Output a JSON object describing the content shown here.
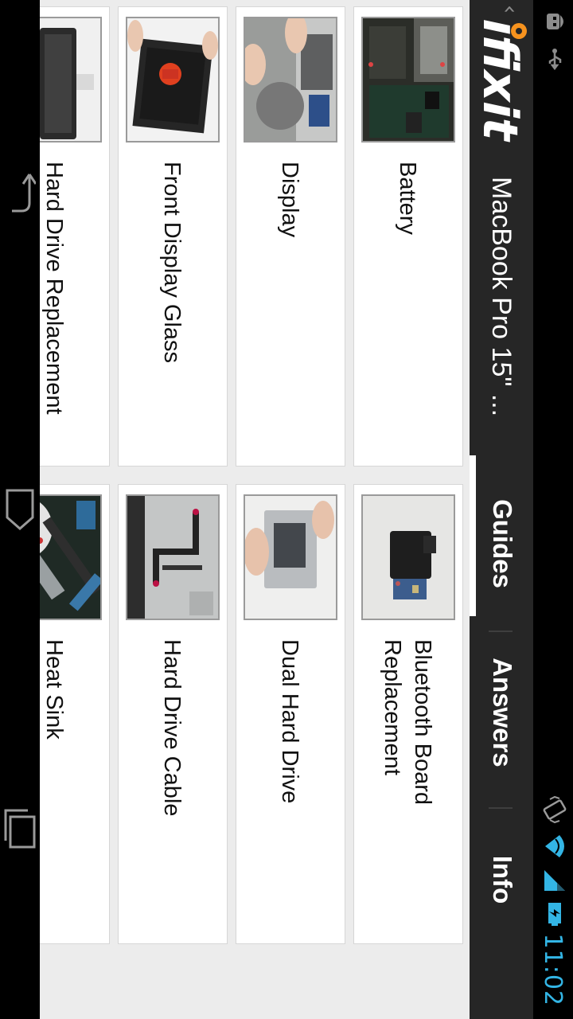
{
  "status_bar": {
    "time": "11:02"
  },
  "action_bar": {
    "logo_text": "ifixit",
    "title": "MacBook Pro 15\" ...",
    "tabs": [
      {
        "label": "Guides",
        "selected": true
      },
      {
        "label": "Answers",
        "selected": false
      },
      {
        "label": "Info",
        "selected": false
      }
    ]
  },
  "guides": [
    {
      "label": "Battery"
    },
    {
      "label": "Bluetooth Board Replacement"
    },
    {
      "label": "Display"
    },
    {
      "label": "Dual Hard Drive"
    },
    {
      "label": "Front Display Glass"
    },
    {
      "label": "Hard Drive Cable"
    },
    {
      "label": "Hard Drive Replacement"
    },
    {
      "label": "Heat Sink"
    }
  ],
  "colors": {
    "accent": "#33b5e5",
    "action_bar": "#262626",
    "logo_orange": "#f7931e"
  }
}
